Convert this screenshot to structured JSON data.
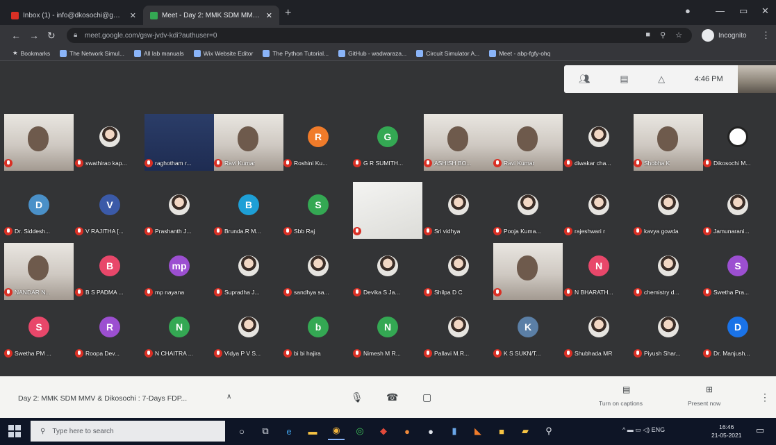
{
  "browser": {
    "tabs": [
      {
        "label": "Inbox (1) - info@dkosochi@gmail...",
        "favicon_color": "#d93025"
      },
      {
        "label": "Meet - Day 2: MMK SDM MMV...",
        "favicon_color": "#34a853"
      }
    ],
    "address": "meet.google.com/gsw-jvdv-kdi?authuser=0",
    "profile_label": "Incognito",
    "bookmarks": [
      "Bookmarks",
      "The Network Simul...",
      "All lab manuals",
      "Wix Website Editor",
      "The Python Tutorial...",
      "GitHub - wadwaraza...",
      "Circuit Simulator A...",
      "Meet - abp-fgfy-ohq"
    ]
  },
  "meet": {
    "time": "4:46 PM",
    "participants": [
      {
        "name": "",
        "kind": "video"
      },
      {
        "name": "swathirao kap...",
        "kind": "avatar",
        "letter": "",
        "color": "photo"
      },
      {
        "name": "raghotham r...",
        "kind": "video-dark"
      },
      {
        "name": "Ravi Kumar",
        "kind": "video"
      },
      {
        "name": "Roshini Ku...",
        "kind": "avatar",
        "letter": "R",
        "color": "#f07b2a"
      },
      {
        "name": "G R SUMITH...",
        "kind": "avatar",
        "letter": "G",
        "color": "#34a853"
      },
      {
        "name": "ASHISH BO...",
        "kind": "video"
      },
      {
        "name": "Ravi Kumar",
        "kind": "video"
      },
      {
        "name": "diwakar cha...",
        "kind": "avatar",
        "letter": "",
        "color": "photo"
      },
      {
        "name": "Shobha K",
        "kind": "video"
      },
      {
        "name": "Dikosochi M...",
        "kind": "avatar",
        "letter": "",
        "color": "#ffffff"
      },
      {
        "name": "Dr. Siddesh...",
        "kind": "avatar",
        "letter": "D",
        "color": "#4a90c8"
      },
      {
        "name": "V RAJITHA [...",
        "kind": "avatar",
        "letter": "V",
        "color": "#3b5aa8"
      },
      {
        "name": "Prashanth J...",
        "kind": "avatar",
        "letter": "",
        "color": "photo"
      },
      {
        "name": "Brunda.R M...",
        "kind": "avatar",
        "letter": "B",
        "color": "#1e9fd6"
      },
      {
        "name": "Sbb Raj",
        "kind": "avatar",
        "letter": "S",
        "color": "#34a853"
      },
      {
        "name": "",
        "kind": "video-paper"
      },
      {
        "name": "Sri vidhya",
        "kind": "avatar",
        "letter": "",
        "color": "photo"
      },
      {
        "name": "Pooja Kuma...",
        "kind": "avatar",
        "letter": "",
        "color": "photo"
      },
      {
        "name": "rajeshwari r",
        "kind": "avatar",
        "letter": "",
        "color": "photo"
      },
      {
        "name": "kavya gowda",
        "kind": "avatar",
        "letter": "",
        "color": "photo"
      },
      {
        "name": "Jamunarani...",
        "kind": "avatar",
        "letter": "",
        "color": "photo"
      },
      {
        "name": "NANDAR N...",
        "kind": "video"
      },
      {
        "name": "B S PADMA ...",
        "kind": "avatar",
        "letter": "B",
        "color": "#e8476a"
      },
      {
        "name": "mp nayana",
        "kind": "avatar",
        "letter": "mp",
        "color": "#9c4fd1"
      },
      {
        "name": "Supradha J...",
        "kind": "avatar",
        "letter": "",
        "color": "photo"
      },
      {
        "name": "sandhya sa...",
        "kind": "avatar",
        "letter": "",
        "color": "photo"
      },
      {
        "name": "Devika S Ja...",
        "kind": "avatar",
        "letter": "",
        "color": "photo"
      },
      {
        "name": "Shilpa D C",
        "kind": "avatar",
        "letter": "",
        "color": "photo"
      },
      {
        "name": "",
        "kind": "video"
      },
      {
        "name": "N BHARATH...",
        "kind": "avatar",
        "letter": "N",
        "color": "#e8476a"
      },
      {
        "name": "chemistry d...",
        "kind": "avatar",
        "letter": "",
        "color": "photo"
      },
      {
        "name": "Swetha Pra...",
        "kind": "avatar",
        "letter": "S",
        "color": "#9c4fd1"
      },
      {
        "name": "Swetha PM ...",
        "kind": "avatar",
        "letter": "S",
        "color": "#e8476a"
      },
      {
        "name": "Roopa Dev...",
        "kind": "avatar",
        "letter": "R",
        "color": "#9c4fd1"
      },
      {
        "name": "N CHAITRA ...",
        "kind": "avatar",
        "letter": "N",
        "color": "#34a853"
      },
      {
        "name": "Vidya P V S...",
        "kind": "avatar",
        "letter": "",
        "color": "photo"
      },
      {
        "name": "bi bi hajira",
        "kind": "avatar",
        "letter": "b",
        "color": "#34a853"
      },
      {
        "name": "Nimesh M R...",
        "kind": "avatar",
        "letter": "N",
        "color": "#34a853"
      },
      {
        "name": "Pallavi M.R...",
        "kind": "avatar",
        "letter": "",
        "color": "photo"
      },
      {
        "name": "K S SUKN/T...",
        "kind": "avatar",
        "letter": "K",
        "color": "#5b7fa6"
      },
      {
        "name": "Shubhada MR",
        "kind": "avatar",
        "letter": "",
        "color": "photo"
      },
      {
        "name": "Piyush Shar...",
        "kind": "avatar",
        "letter": "",
        "color": "photo"
      },
      {
        "name": "Dr. Manjush...",
        "kind": "avatar",
        "letter": "D",
        "color": "#1a73e8"
      }
    ],
    "meeting_title": "Day 2: MMK SDM MMV & Dikosochi : 7-Days FDP...",
    "captions_label": "Turn on captions",
    "present_label": "Present now"
  },
  "taskbar": {
    "search_placeholder": "Type here to search",
    "lang": "ENG",
    "time": "16:46",
    "date": "21-05-2021"
  }
}
